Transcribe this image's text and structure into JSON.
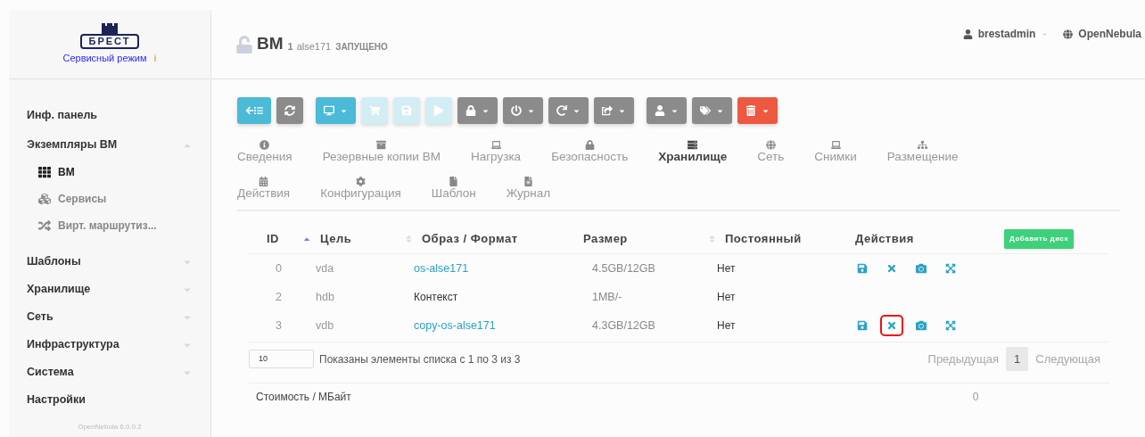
{
  "sidebar": {
    "logo": "БРЕСТ",
    "mode": "Сервисный режим",
    "mode_info": "i",
    "items": [
      {
        "label": "Инф. панель",
        "kind": "link"
      },
      {
        "label": "Экземпляры ВМ",
        "kind": "group",
        "expanded": true,
        "children": [
          {
            "label": "ВМ",
            "selected": true
          },
          {
            "label": "Сервисы",
            "selected": false
          },
          {
            "label": "Вирт. маршрутиз...",
            "selected": false
          }
        ]
      },
      {
        "label": "Шаблоны",
        "kind": "group",
        "expanded": false
      },
      {
        "label": "Хранилище",
        "kind": "group",
        "expanded": false
      },
      {
        "label": "Сеть",
        "kind": "group",
        "expanded": false
      },
      {
        "label": "Инфраструктура",
        "kind": "group",
        "expanded": false
      },
      {
        "label": "Система",
        "kind": "group",
        "expanded": false
      },
      {
        "label": "Настройки",
        "kind": "link"
      }
    ],
    "version": "OpenNebula 6.0.0.2"
  },
  "header": {
    "title": "ВМ",
    "id": "1",
    "name": "alse171",
    "state": "ЗАПУЩЕНО",
    "user": "brestadmin",
    "zone": "OpenNebula"
  },
  "toolbar": [
    {
      "kind": "back",
      "disabled": false
    },
    {
      "kind": "refresh",
      "disabled": false
    },
    {
      "kind": "desktop",
      "disabled": false
    },
    {
      "kind": "cart",
      "disabled": true
    },
    {
      "kind": "save",
      "disabled": true
    },
    {
      "kind": "play",
      "disabled": true
    },
    {
      "kind": "lock",
      "disabled": false
    },
    {
      "kind": "power",
      "disabled": false
    },
    {
      "kind": "redo",
      "disabled": false
    },
    {
      "kind": "share",
      "disabled": false
    },
    {
      "kind": "user",
      "disabled": false
    },
    {
      "kind": "tags",
      "disabled": false
    },
    {
      "kind": "trash",
      "disabled": false
    }
  ],
  "tab_rows": [
    [
      {
        "label": "Сведения",
        "selected": false
      },
      {
        "label": "Резервные копии ВМ",
        "selected": false
      },
      {
        "label": "Нагрузка",
        "selected": false
      },
      {
        "label": "Безопасность",
        "selected": false
      },
      {
        "label": "Хранилище",
        "selected": true
      },
      {
        "label": "Сеть",
        "selected": false
      },
      {
        "label": "Снимки",
        "selected": false
      },
      {
        "label": "Размещение",
        "selected": false
      }
    ],
    [
      {
        "label": "Действия",
        "selected": false
      },
      {
        "label": "Конфигурация",
        "selected": false
      },
      {
        "label": "Шаблон",
        "selected": false
      },
      {
        "label": "Журнал",
        "selected": false
      }
    ]
  ],
  "table": {
    "columns": [
      "ID",
      "Цель",
      "Образ / Формат",
      "Размер",
      "Постоянный",
      "Действия"
    ],
    "add_button": "Добавить диск",
    "rows": [
      {
        "id": "0",
        "target": "vda",
        "image": "os-alse171",
        "kind": "link",
        "size": "4.5GB/12GB",
        "persistent": "Нет",
        "actions": [
          {
            "kind": "save",
            "highlighted": false
          },
          {
            "kind": "detach",
            "highlighted": false
          },
          {
            "kind": "snapshot",
            "highlighted": false
          },
          {
            "kind": "resize",
            "highlighted": false
          }
        ]
      },
      {
        "id": "2",
        "target": "hdb",
        "image": "Контекст",
        "kind": "text",
        "size": "1MB/-",
        "persistent": "Нет"
      },
      {
        "id": "3",
        "target": "vdb",
        "image": "copy-os-alse171",
        "kind": "link",
        "size": "4.3GB/12GB",
        "persistent": "Нет",
        "actions": [
          {
            "kind": "save",
            "highlighted": false
          },
          {
            "kind": "detach",
            "highlighted": true
          },
          {
            "kind": "snapshot",
            "highlighted": false
          },
          {
            "kind": "resize",
            "highlighted": false
          }
        ]
      }
    ],
    "page_size": "10",
    "info": "Показаны элементы списка с 1 по 3 из 3",
    "pagination": [
      {
        "label": "Предыдущая",
        "selected": false
      },
      {
        "label": "1",
        "selected": true
      },
      {
        "label": "Следующая",
        "selected": false
      }
    ]
  },
  "cost": {
    "label": "Стоимость / МБайт",
    "value": "0"
  }
}
